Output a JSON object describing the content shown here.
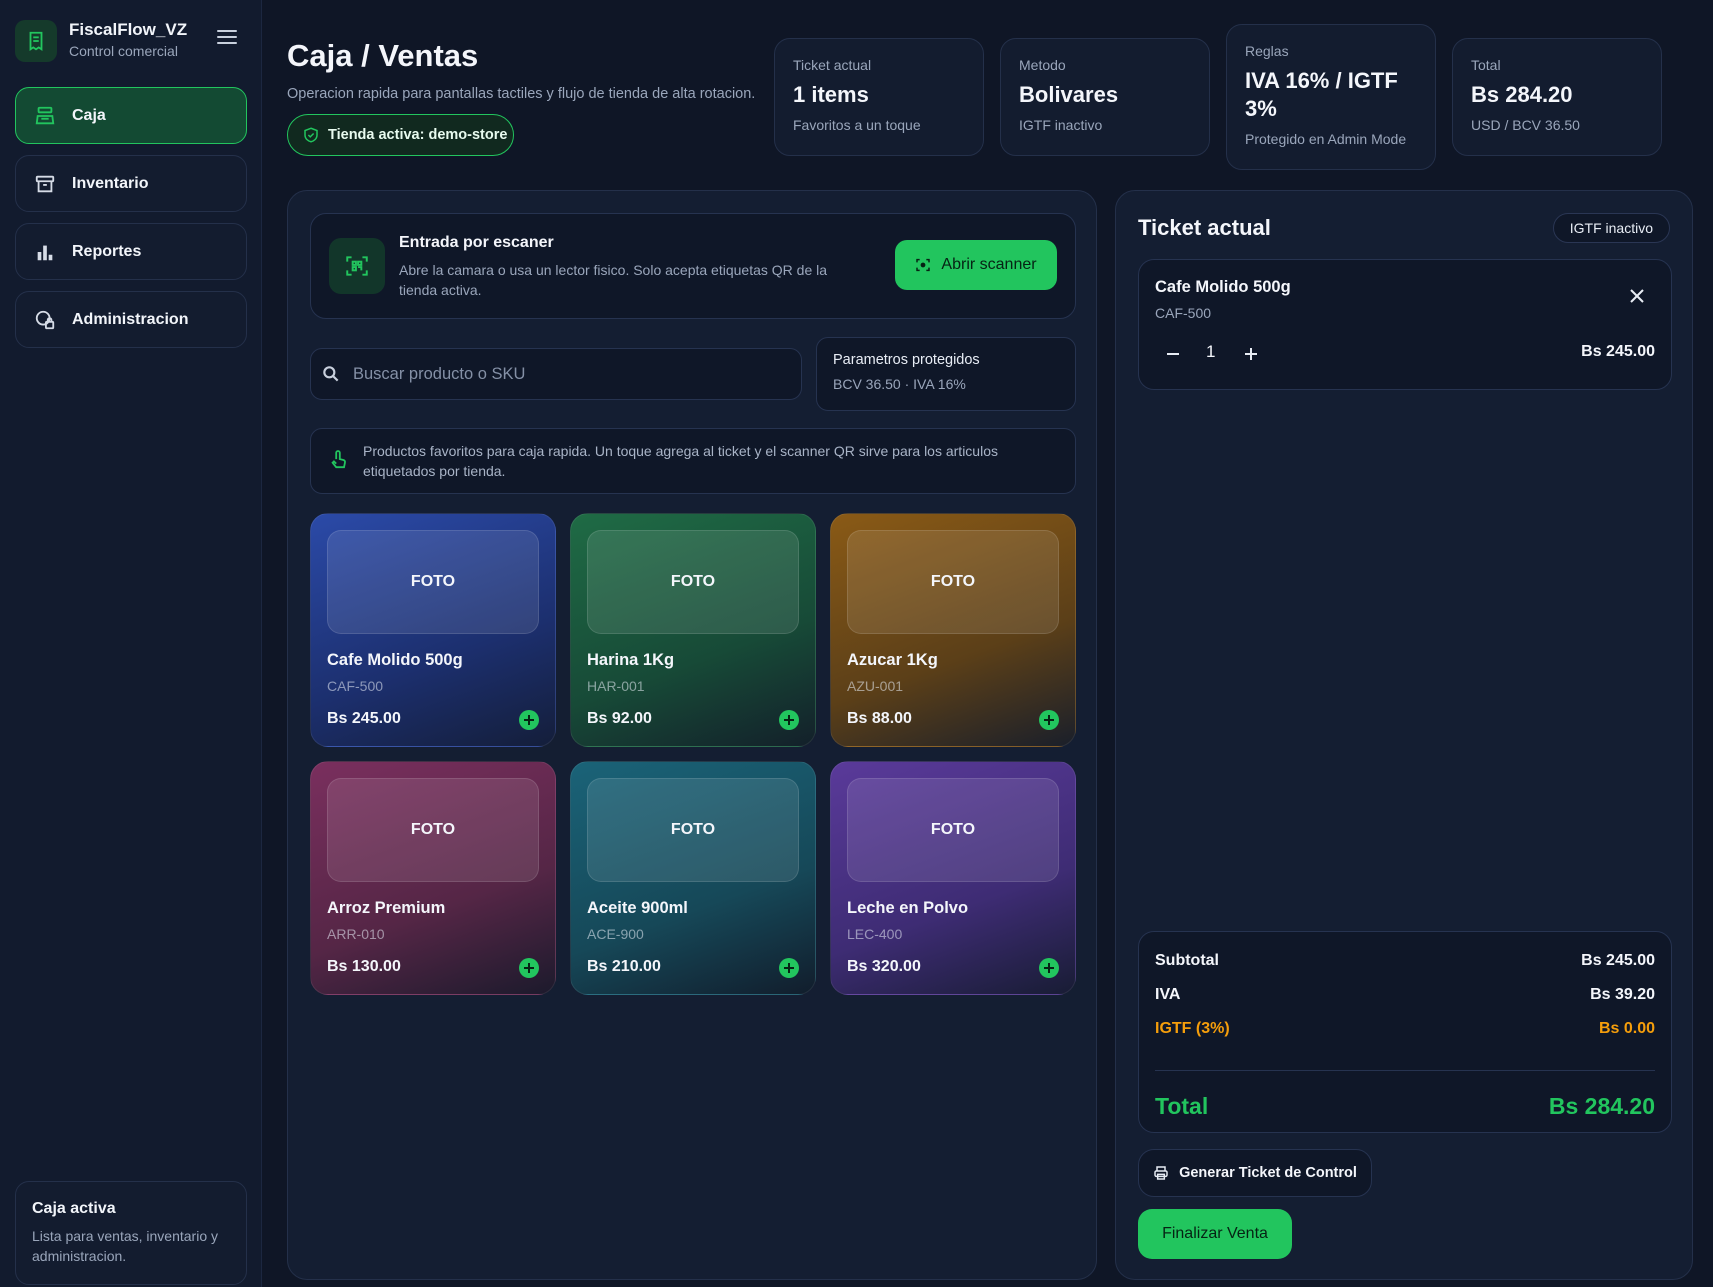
{
  "brand": {
    "title": "FiscalFlow_VZ",
    "subtitle": "Control comercial",
    "icon": "receipt-icon"
  },
  "sidebar": {
    "items": [
      {
        "label": "Caja",
        "icon": "cash-register-icon",
        "active": true
      },
      {
        "label": "Inventario",
        "icon": "archive-box-icon",
        "active": false
      },
      {
        "label": "Reportes",
        "icon": "bar-chart-icon",
        "active": false
      },
      {
        "label": "Administracion",
        "icon": "admin-lock-icon",
        "active": false
      }
    ],
    "footer": {
      "title": "Caja activa",
      "text": "Lista para ventas, inventario y administracion."
    }
  },
  "header": {
    "title": "Caja / Ventas",
    "subtitle": "Operacion rapida para pantallas tactiles y flujo de tienda de alta rotacion.",
    "store_pill": "Tienda activa: demo-store"
  },
  "stats": [
    {
      "label": "Ticket actual",
      "value": "1 items",
      "note": "Favoritos a un toque"
    },
    {
      "label": "Metodo",
      "value": "Bolivares",
      "note": "IGTF inactivo"
    },
    {
      "label": "Reglas",
      "value": "IVA 16% / IGTF 3%",
      "note": "Protegido en Admin Mode"
    },
    {
      "label": "Total",
      "value": "Bs 284.20",
      "note": "USD / BCV 36.50"
    }
  ],
  "scanner": {
    "title": "Entrada por escaner",
    "description": "Abre la camara o usa un lector fisico. Solo acepta etiquetas QR de la tienda activa.",
    "button": "Abrir scanner"
  },
  "search": {
    "placeholder": "Buscar producto o SKU",
    "value": ""
  },
  "params": {
    "title": "Parametros protegidos",
    "value": "BCV 36.50 · IVA 16%"
  },
  "info": {
    "text": "Productos favoritos para caja rapida. Un toque agrega al ticket y el scanner QR sirve para los articulos etiquetados por tienda."
  },
  "products": [
    {
      "foto": "FOTO",
      "name": "Cafe Molido 500g",
      "sku": "CAF-500",
      "price": "Bs 245.00",
      "color": "#2b4aa8"
    },
    {
      "foto": "FOTO",
      "name": "Harina 1Kg",
      "sku": "HAR-001",
      "price": "Bs 92.00",
      "color": "#1f6b45"
    },
    {
      "foto": "FOTO",
      "name": "Azucar 1Kg",
      "sku": "AZU-001",
      "price": "Bs 88.00",
      "color": "#8a5a16"
    },
    {
      "foto": "FOTO",
      "name": "Arroz Premium",
      "sku": "ARR-010",
      "price": "Bs 130.00",
      "color": "#7a2f5e"
    },
    {
      "foto": "FOTO",
      "name": "Aceite 900ml",
      "sku": "ACE-900",
      "price": "Bs 210.00",
      "color": "#1a6378"
    },
    {
      "foto": "FOTO",
      "name": "Leche en Polvo",
      "sku": "LEC-400",
      "price": "Bs 320.00",
      "color": "#5a3a9a"
    }
  ],
  "ticket": {
    "title": "Ticket actual",
    "badge": "IGTF inactivo",
    "item": {
      "name": "Cafe Molido 500g",
      "sku": "CAF-500",
      "qty": "1",
      "price": "Bs 245.00"
    },
    "totals": {
      "subtotal_label": "Subtotal",
      "subtotal": "Bs 245.00",
      "iva_label": "IVA",
      "iva": "Bs 39.20",
      "igtf_label": "IGTF (3%)",
      "igtf": "Bs 0.00",
      "total_label": "Total",
      "total": "Bs 284.20"
    },
    "gen_button": "Generar Ticket de Control",
    "finalize_button": "Finalizar Venta"
  },
  "colors": {
    "accent": "#22c55e",
    "warning": "#f59e0b",
    "background": "#0f1626",
    "panel": "#141e32"
  }
}
